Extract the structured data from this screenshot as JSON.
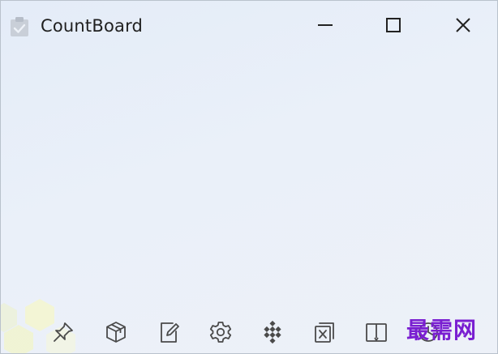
{
  "window": {
    "title": "CountBoard",
    "app_icon": "clipboard-check-icon",
    "controls": [
      {
        "name": "minimize",
        "icon": "minimize-icon"
      },
      {
        "name": "maximize",
        "icon": "maximize-icon"
      },
      {
        "name": "close",
        "icon": "close-icon"
      }
    ]
  },
  "toolbar": {
    "items": [
      {
        "icon": "pin-icon"
      },
      {
        "icon": "cube-icon"
      },
      {
        "icon": "edit-icon"
      },
      {
        "icon": "gear-icon"
      },
      {
        "icon": "checkerboard-icon"
      },
      {
        "icon": "copy-close-icon"
      },
      {
        "icon": "book-icon"
      },
      {
        "icon": "clock-icon"
      }
    ]
  },
  "watermark": {
    "text": "最需网",
    "color": "#7a1fd1"
  },
  "colors": {
    "background": "#e9eff8",
    "icon": "#4a4a4a",
    "title_text": "#1f1f1f"
  }
}
